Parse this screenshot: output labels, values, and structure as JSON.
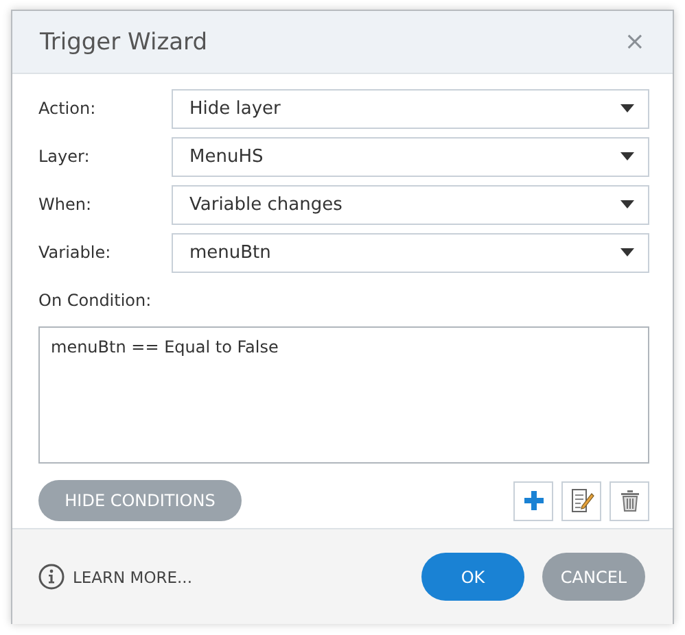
{
  "window": {
    "title": "Trigger Wizard",
    "close": "×"
  },
  "fields": [
    {
      "label": "Action:",
      "value": "Hide layer"
    },
    {
      "label": "Layer:",
      "value": "MenuHS"
    },
    {
      "label": "When:",
      "value": "Variable changes"
    },
    {
      "label": "Variable:",
      "value": "menuBtn"
    }
  ],
  "conditions": {
    "label": "On Condition:",
    "items": [
      "menuBtn == Equal to False"
    ]
  },
  "hide_conditions_button": "HIDE CONDITIONS",
  "footer": {
    "learn_more": "LEARN MORE...",
    "buttons": [
      {
        "label": "OK",
        "kind": "primary"
      },
      {
        "label": "CANCEL",
        "kind": "secondary"
      }
    ]
  }
}
